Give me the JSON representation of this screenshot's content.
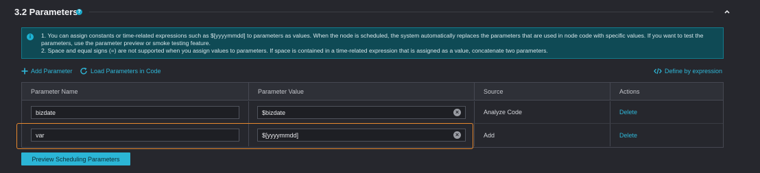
{
  "section": {
    "title": "3.2 Parameters",
    "help_icon": "question-icon",
    "collapse_icon": "chevron-up-icon"
  },
  "notice": {
    "icon": "info-icon",
    "line1": "1. You can assign constants or time-related expressions such as $[yyyymmdd] to parameters as values. When the node is scheduled, the system automatically replaces the parameters that are used in node code with specific values. If you want to test the parameters, use the parameter preview or smoke testing feature.",
    "line2": "2. Space and equal signs (=) are not supported when you assign values to parameters. If space is contained in a time-related expression that is assigned as a value, concatenate two parameters."
  },
  "toolbar": {
    "add_parameter": "Add Parameter",
    "load_parameters": "Load Parameters in Code",
    "define_by_expression": "Define by expression"
  },
  "table": {
    "headers": [
      "Parameter Name",
      "Parameter Value",
      "Source",
      "Actions"
    ],
    "rows": [
      {
        "name": "bizdate",
        "value": "$bizdate",
        "source": "Analyze Code",
        "action": "Delete"
      },
      {
        "name": "var",
        "value": "$[yyyymmdd]",
        "source": "Add",
        "action": "Delete"
      }
    ]
  },
  "preview_button": "Preview Scheduling Parameters",
  "colors": {
    "accent": "#2fb7d8",
    "highlight": "#e8892f",
    "background": "#26272d",
    "notice_bg": "#0f4a55"
  }
}
